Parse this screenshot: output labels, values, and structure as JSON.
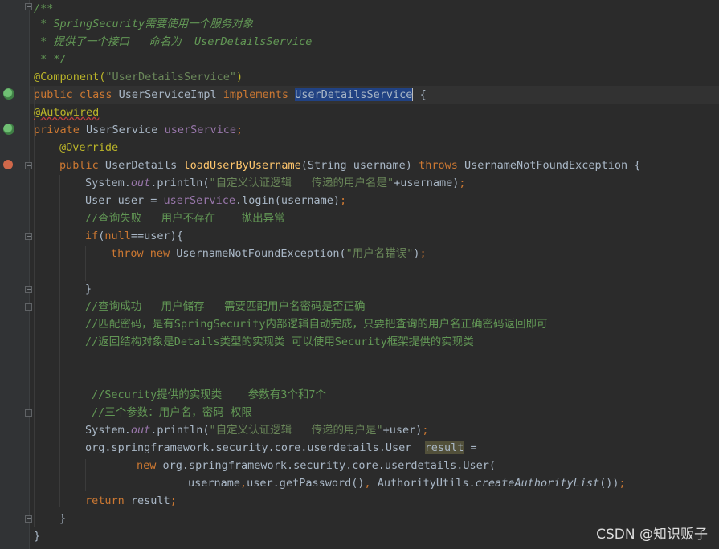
{
  "editor": {
    "lines": {
      "l1": "/**",
      "l2a": " * SpringSecurity",
      "l2b": "需要使用一个服务对象",
      "l3a": " * 提供了一个接口   命名为  ",
      "l3b": "UserDetailsService",
      "l4": " * */",
      "l5a": "@Component(",
      "l5b": "\"UserDetailsService\"",
      "l5c": ")",
      "l6a": "public class ",
      "l6b": "UserServiceImpl ",
      "l6c": "implements ",
      "l6d": "UserDetailsService",
      "l6e": " {",
      "l7": "@Autowired",
      "l8a": "private ",
      "l8b": "UserService ",
      "l8c": "userService",
      "l8d": ";",
      "l9": "@Override",
      "l10a": "public ",
      "l10b": "UserDetails ",
      "l10c": "loadUserByUsername",
      "l10d": "(String username) ",
      "l10e": "throws ",
      "l10f": "UsernameNotFoundException {",
      "l11a": "System.",
      "l11b": "out",
      "l11c": ".println(",
      "l11d": "\"自定义认证逻辑   传递的用户名是\"",
      "l11e": "+username)",
      "l11f": ";",
      "l12a": "User user = ",
      "l12b": "userService",
      "l12c": ".login(username)",
      "l12d": ";",
      "l13": "//查询失败   用户不存在    抛出异常",
      "l14a": "if",
      "l14b": "(",
      "l14c": "null",
      "l14d": "==user){",
      "l15a": "throw new ",
      "l15b": "UsernameNotFoundException(",
      "l15c": "\"用户名错误\"",
      "l15d": ")",
      "l15e": ";",
      "l16": "}",
      "l17": "//查询成功   用户储存   需要匹配用户名密码是否正确",
      "l18": "//匹配密码，是有SpringSecurity内部逻辑自动完成，只要把查询的用户名正确密码返回即可",
      "l19": "//返回结构对象是Details类型的实现类 可以使用Security框架提供的实现类",
      "l20": "//Security提供的实现类    参数有3个和7个",
      "l21": "//三个参数：用户名，密码 权限",
      "l22a": "System.",
      "l22b": "out",
      "l22c": ".println(",
      "l22d": "\"自定义认证逻辑   传递的用户是\"",
      "l22e": "+user)",
      "l22f": ";",
      "l23a": "org.springframework.security.core.userdetails.User  ",
      "l23b": "result",
      "l23c": " =",
      "l24a": "new ",
      "l24b": "org.springframework.security.core.userdetails.User(",
      "l25a": "username",
      "l25b": ",",
      "l25c": "user.getPassword()",
      "l25d": ", ",
      "l25e": "AuthorityUtils.",
      "l25f": "createAuthorityList",
      "l25g": "())",
      "l25h": ";",
      "l26a": "return ",
      "l26b": "result",
      "l26c": ";",
      "l27": "}",
      "l28": "}"
    }
  },
  "watermark": "CSDN @知识贩子",
  "colors": {
    "background": "#2b2b2b",
    "keyword": "#cc7832",
    "comment": "#629755",
    "string": "#6a8759",
    "annotation": "#bbb529",
    "field": "#9876aa",
    "method": "#ffc66d",
    "selection": "#214283"
  },
  "icons": [
    "spring-bean-icon",
    "autowired-bean-icon",
    "override-method-icon"
  ]
}
